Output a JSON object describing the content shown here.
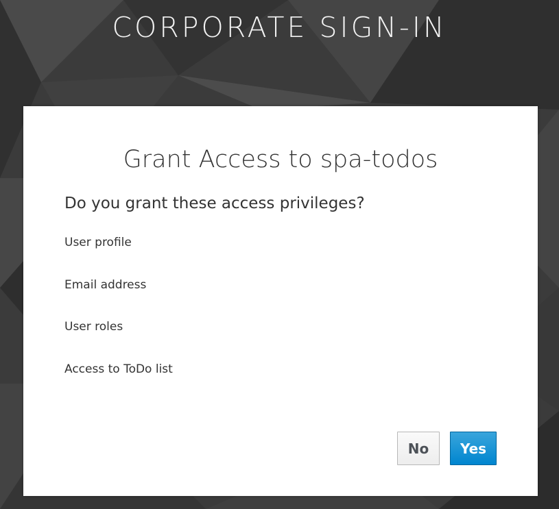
{
  "header": {
    "title": "CORPORATE SIGN-IN"
  },
  "dialog": {
    "title": "Grant Access to spa-todos",
    "question": "Do you grant these access privileges?",
    "privileges": [
      "User profile",
      "Email address",
      "User roles",
      "Access to ToDo list"
    ],
    "buttons": {
      "no_label": "No",
      "yes_label": "Yes"
    }
  },
  "colors": {
    "primary_button": "#0085cf",
    "background": "#3a3a3a"
  }
}
